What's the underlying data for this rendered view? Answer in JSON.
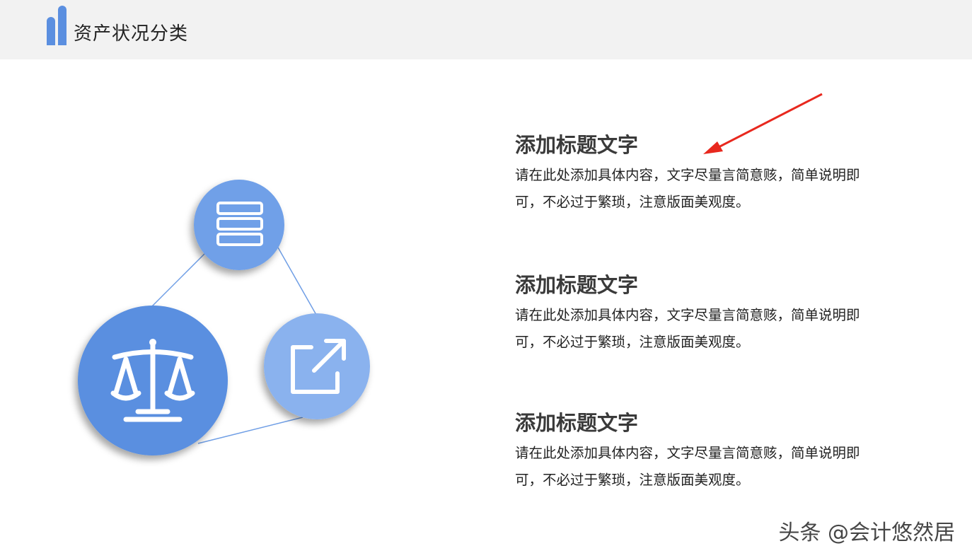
{
  "header": {
    "title": "资产状况分类"
  },
  "diagram": {
    "nodes": [
      {
        "name": "list-icon",
        "color": "#6fa0e8"
      },
      {
        "name": "balance-scale-icon",
        "color": "#5a8fe0"
      },
      {
        "name": "external-link-icon",
        "color": "#8ab2ee"
      }
    ]
  },
  "items": [
    {
      "title": "添加标题文字",
      "body": "请在此处添加具体内容，文字尽量言简意赅，简单说明即可，不必过于繁琐，注意版面美观度。"
    },
    {
      "title": "添加标题文字",
      "body": "请在此处添加具体内容，文字尽量言简意赅，简单说明即可，不必过于繁琐，注意版面美观度。"
    },
    {
      "title": "添加标题文字",
      "body": "请在此处添加具体内容，文字尽量言简意赅，简单说明即可，不必过于繁琐，注意版面美观度。"
    }
  ],
  "annotation": {
    "color": "#e8281e"
  },
  "watermark": "头条 @会计悠然居"
}
